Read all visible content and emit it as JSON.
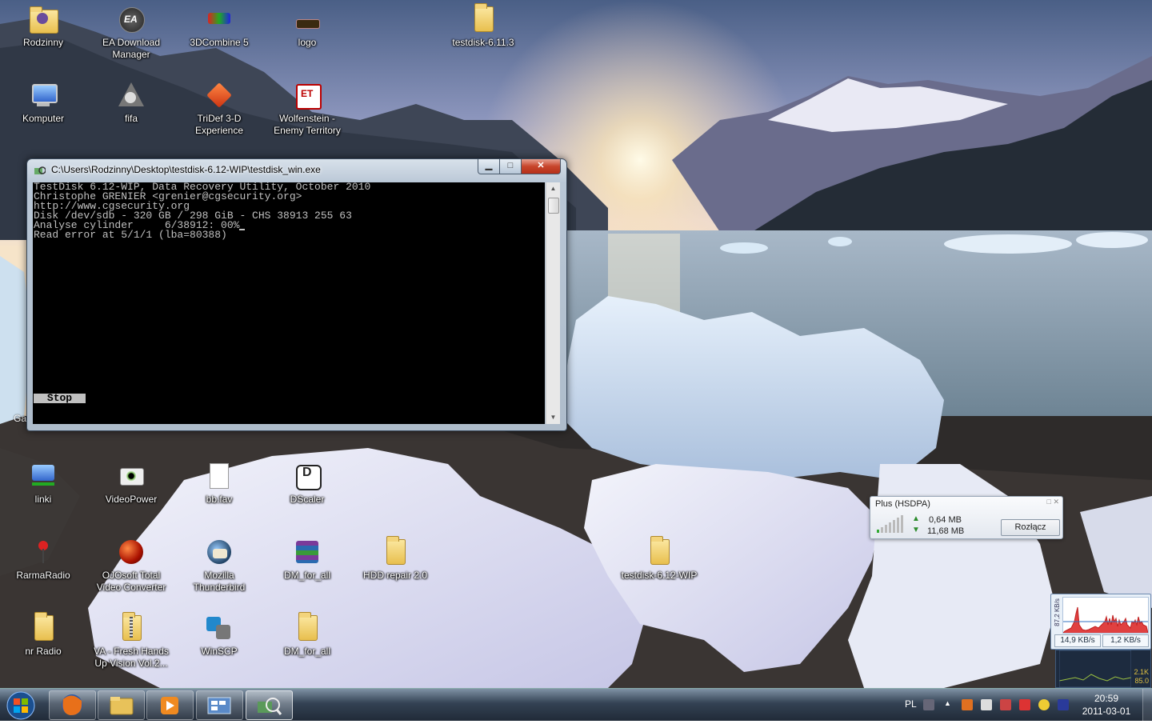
{
  "desktop_icons": [
    {
      "label": "Rodzinny",
      "icon": "user-folder-icon"
    },
    {
      "label": "EA Download Manager",
      "icon": "ea-icon"
    },
    {
      "label": "3DCombine 5",
      "icon": "3dcombine-icon"
    },
    {
      "label": "logo",
      "icon": "logo-icon"
    },
    {
      "label": "testdisk-6.11.3",
      "icon": "folder-icon"
    },
    {
      "label": "Komputer",
      "icon": "computer-icon"
    },
    {
      "label": "fifa",
      "icon": "fifa-icon"
    },
    {
      "label": "TriDef 3-D Experience",
      "icon": "tridef-icon"
    },
    {
      "label": "Wolfenstein - Enemy Territory",
      "icon": "wolfenstein-icon"
    },
    {
      "label": "linki",
      "icon": "network-folder-icon"
    },
    {
      "label": "VideoPower",
      "icon": "eye-icon"
    },
    {
      "label": "bb.fav",
      "icon": "document-icon"
    },
    {
      "label": "DScaler",
      "icon": "dscaler-icon"
    },
    {
      "label": "RarmaRadio",
      "icon": "radio-icon"
    },
    {
      "label": "OJOsoft Total Video Converter",
      "icon": "video-converter-icon"
    },
    {
      "label": "Mozilla Thunderbird",
      "icon": "thunderbird-icon"
    },
    {
      "label": "DM_for_all",
      "icon": "winrar-icon"
    },
    {
      "label": "HDD repair 2.0",
      "icon": "folder-icon"
    },
    {
      "label": "testdisk-6.12-WIP",
      "icon": "folder-icon"
    },
    {
      "label": "nr Radio",
      "icon": "folder-icon"
    },
    {
      "label": "VA - Fresh Hands Up Vision Vol.2...",
      "icon": "zip-folder-icon"
    },
    {
      "label": "WinSCP",
      "icon": "winscp-icon"
    },
    {
      "label": "DM_for_all",
      "icon": "folder-icon"
    },
    {
      "label": "Ga",
      "icon": "partial-icon"
    }
  ],
  "console_window": {
    "title": "C:\\Users\\Rodzinny\\Desktop\\testdisk-6.12-WIP\\testdisk_win.exe",
    "lines": [
      "TestDisk 6.12-WIP, Data Recovery Utility, October 2010",
      "Christophe GRENIER <grenier@cgsecurity.org>",
      "http://www.cgsecurity.org",
      "",
      "Disk /dev/sdb - 320 GB / 298 GiB - CHS 38913 255 63",
      "Analyse cylinder     6/38912: 00%",
      "Read error at 5/1/1 (lba=80388)"
    ],
    "stop_label": "Stop",
    "min_glyph": "▁",
    "max_glyph": "□",
    "close_glyph": "✕"
  },
  "network_widget": {
    "title": "Plus (HSDPA)",
    "sent": "0,64 MB",
    "received": "11,68 MB",
    "disconnect_label": "Rozłącz",
    "window_glyphs": "□ ✕"
  },
  "speed_widget": {
    "axis_label": "87,2 KB/s",
    "down_speed": "14,9 KB/s",
    "up_speed": "1,2 KB/s"
  },
  "meter_widget": {
    "value1": "2.1K",
    "value2": "85.0"
  },
  "taskbar": {
    "buttons": [
      "firefox-icon",
      "explorer-icon",
      "media-player-icon",
      "control-panel-icon",
      "testdisk-icon"
    ],
    "tray": {
      "language": "PL",
      "time": "20:59",
      "date": "2011-03-01"
    }
  },
  "colors": {
    "console_bg": "#000000",
    "console_text": "#c0c0c0",
    "taskbar": "#2d3c4e"
  }
}
